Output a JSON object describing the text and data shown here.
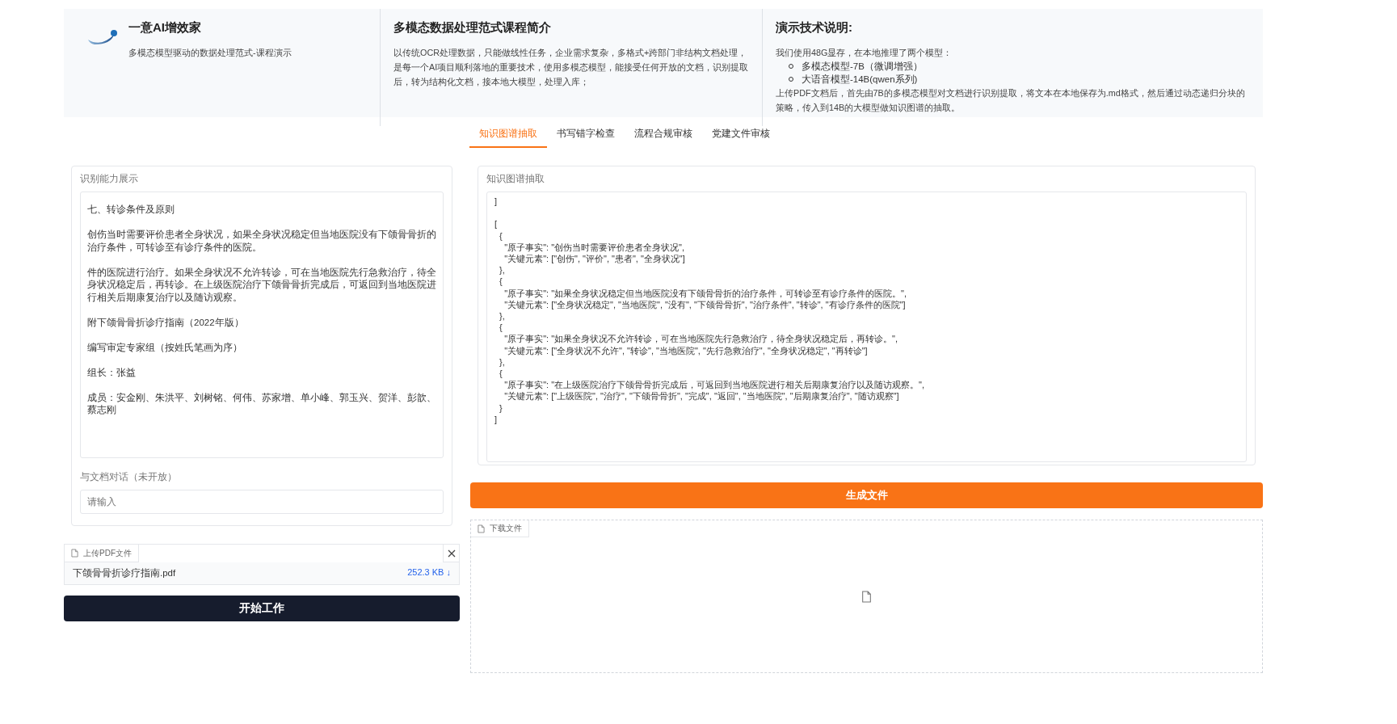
{
  "header": {
    "brand": {
      "title": "一意AI增效家",
      "subtitle": "多模态模型驱动的数据处理范式-课程演示"
    },
    "intro": {
      "title": "多模态数据处理范式课程简介",
      "text": "以传统OCR处理数据，只能做线性任务，企业需求复杂，多格式+跨部门非结构文档处理，是每一个AI项目顺利落地的重要技术，使用多模态模型，能接受任何开放的文档，识别提取后，转为结构化文档，接本地大模型，处理入库；"
    },
    "tech": {
      "title": "演示技术说明:",
      "lead": "我们使用48G显存，在本地推理了两个模型：",
      "models": [
        "多模态模型-7B（微调增强）",
        "大语音模型-14B(qwen系列)"
      ],
      "text": "上传PDF文档后，首先由7B的多模态模型对文档进行识别提取，将文本在本地保存为.md格式，然后通过动态递归分块的策略，传入到14B的大模型做知识图谱的抽取。"
    }
  },
  "tabs": [
    {
      "label": "知识图谱抽取",
      "selected": true
    },
    {
      "label": "书写错字检查",
      "selected": false
    },
    {
      "label": "流程合规审核",
      "selected": false
    },
    {
      "label": "党建文件审核",
      "selected": false
    }
  ],
  "recognition": {
    "label": "识别能力展示",
    "paragraphs": [
      "七、转诊条件及原则",
      "创伤当时需要评价患者全身状况，如果全身状况稳定但当地医院没有下颌骨骨折的治疗条件，可转诊至有诊疗条件的医院。",
      "件的医院进行治疗。如果全身状况不允许转诊，可在当地医院先行急救治疗，待全身状况稳定后，再转诊。在上级医院治疗下颌骨骨折完成后，可返回到当地医院进行相关后期康复治疗以及随访观察。",
      "附下颌骨骨折诊疗指南（2022年版）",
      "编写审定专家组（按姓氏笔画为序）",
      "组长：张益",
      "成员：安金刚、朱洪平、刘树铭、何伟、苏家增、单小峰、郭玉兴、贺洋、彭歆、蔡志刚"
    ]
  },
  "chat": {
    "label": "与文档对话（未开放）",
    "placeholder": "请输入"
  },
  "upload": {
    "label": "上传PDF文件",
    "file_name": "下颌骨骨折诊疗指南.pdf",
    "file_size": "252.3 KB ↓"
  },
  "start_button": "开始工作",
  "extraction": {
    "label": "知识图谱抽取",
    "blocks": [
      [
        "]"
      ],
      [
        "[",
        "  {",
        "    \"原子事实\": \"创伤当时需要评价患者全身状况\",",
        "    \"关键元素\": [\"创伤\", \"评价\", \"患者\", \"全身状况\"]",
        "  },",
        "  {",
        "    \"原子事实\": \"如果全身状况稳定但当地医院没有下颌骨骨折的治疗条件，可转诊至有诊疗条件的医院。\",",
        "    \"关键元素\": [\"全身状况稳定\", \"当地医院\", \"没有\", \"下颌骨骨折\", \"治疗条件\", \"转诊\", \"有诊疗条件的医院\"]",
        "  },",
        "  {",
        "    \"原子事实\": \"如果全身状况不允许转诊，可在当地医院先行急救治疗，待全身状况稳定后，再转诊。\",",
        "    \"关键元素\": [\"全身状况不允许\", \"转诊\", \"当地医院\", \"先行急救治疗\", \"全身状况稳定\", \"再转诊\"]",
        "  },",
        "  {",
        "    \"原子事实\": \"在上级医院治疗下颌骨骨折完成后，可返回到当地医院进行相关后期康复治疗以及随访观察。\",",
        "    \"关键元素\": [\"上级医院\", \"治疗\", \"下颌骨骨折\", \"完成\", \"返回\", \"当地医院\", \"后期康复治疗\", \"随访观察\"]",
        "  }",
        "]"
      ]
    ]
  },
  "generate_button": "生成文件",
  "download": {
    "label": "下载文件"
  }
}
